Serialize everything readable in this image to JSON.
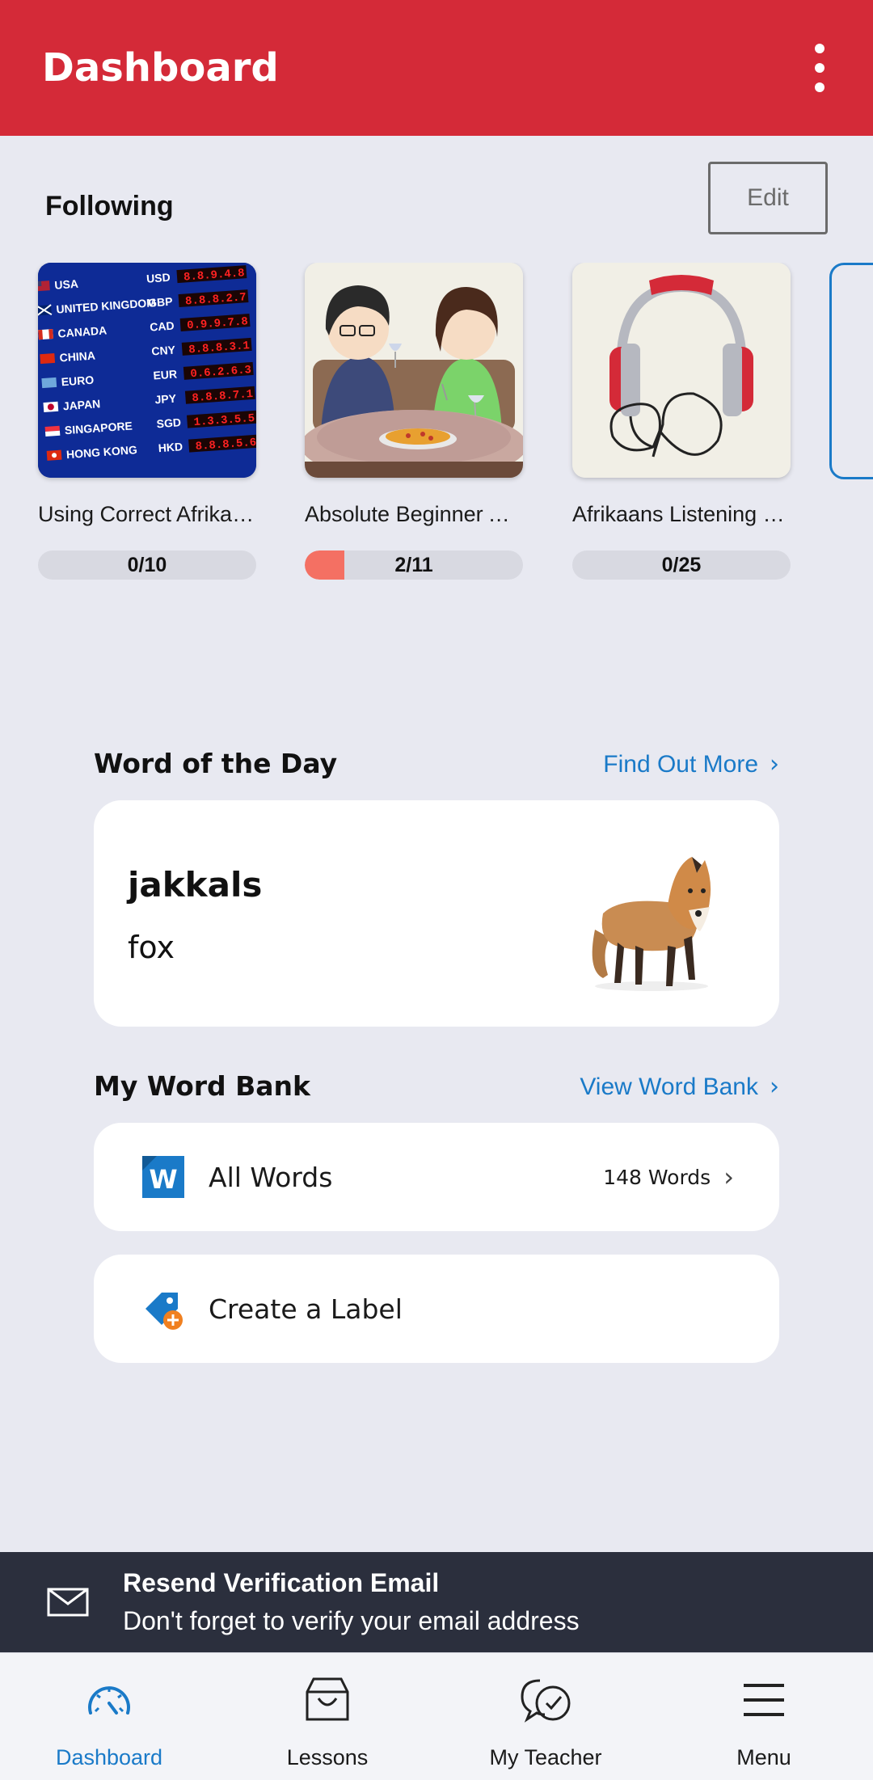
{
  "app_bar": {
    "title": "Dashboard",
    "more_icon": "kebab-menu-icon"
  },
  "following": {
    "title": "Following",
    "edit_label": "Edit",
    "courses": [
      {
        "name": "Using Correct Afrikaans at the Ba…",
        "progress_text": "0/10",
        "progress_fraction": 0.0
      },
      {
        "name": "Absolute Beginner Afrikaans for Every…",
        "progress_text": "2/11",
        "progress_fraction": 0.18
      },
      {
        "name": "Afrikaans Listening Comprehension for…",
        "progress_text": "0/25",
        "progress_fraction": 0.0
      }
    ]
  },
  "word_of_the_day": {
    "title": "Word of the Day",
    "link_label": "Find Out More",
    "word": "jakkals",
    "translation": "fox"
  },
  "word_bank": {
    "title": "My Word Bank",
    "link_label": "View Word Bank",
    "all_words_label": "All Words",
    "all_words_count": "148 Words",
    "create_label": "Create a Label"
  },
  "banner": {
    "title": "Resend Verification Email",
    "subtitle": "Don't forget to verify your email address"
  },
  "bottom_nav": {
    "items": [
      {
        "label": "Dashboard",
        "icon": "dashboard-gauge-icon",
        "active": true
      },
      {
        "label": "Lessons",
        "icon": "lessons-inbox-icon",
        "active": false
      },
      {
        "label": "My Teacher",
        "icon": "chat-bubbles-icon",
        "active": false
      },
      {
        "label": "Menu",
        "icon": "hamburger-menu-icon",
        "active": false
      }
    ]
  },
  "colors": {
    "brand_red": "#d42a38",
    "accent_blue": "#1a7ac8",
    "progress_fill": "#f47063",
    "banner_bg": "#2b2f3d"
  }
}
